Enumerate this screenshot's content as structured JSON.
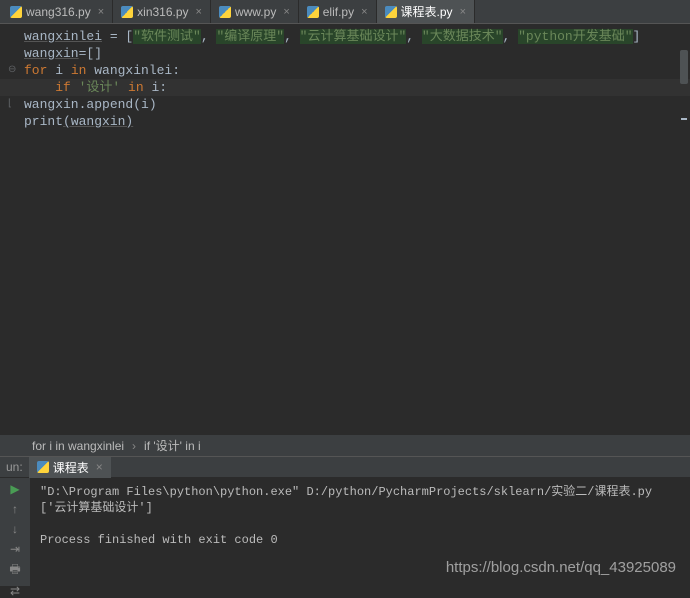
{
  "tabs": [
    {
      "label": "wang316.py",
      "active": false
    },
    {
      "label": "xin316.py",
      "active": false
    },
    {
      "label": "www.py",
      "active": false
    },
    {
      "label": "elif.py",
      "active": false
    },
    {
      "label": "课程表.py",
      "active": true
    }
  ],
  "code": {
    "l1_var": "wangxinlei",
    "l1_eq": " = [",
    "l1_s1": "\"软件测试\"",
    "l1_s2": "\"编译原理\"",
    "l1_s3": "\"云计算基础设计\"",
    "l1_s4": "\"大数据技术\"",
    "l1_s5": "\"python开发基础\"",
    "l1_close": "]",
    "l2_var": "wangxin",
    "l2_rest": "=[]",
    "l3_for": "for",
    "l3_i": " i ",
    "l3_in": "in",
    "l3_col": " wangxinlei:",
    "l4_if": "if ",
    "l4_str": "'设计'",
    "l4_in": " in ",
    "l4_rest": "i:",
    "l5": "        wangxin.append(i)",
    "l6_print": "print",
    "l6_arg": "(wangxin)"
  },
  "breadcrumb": {
    "a": "for i in wangxinlei",
    "b": "if '设计' in i"
  },
  "run": {
    "label": "un:",
    "tab": "课程表",
    "out1": "\"D:\\Program Files\\python\\python.exe\" D:/python/PycharmProjects/sklearn/实验二/课程表.py",
    "out2": "['云计算基础设计']",
    "out3": "",
    "out4": "Process finished with exit code 0"
  },
  "watermark": "https://blog.csdn.net/qq_43925089"
}
